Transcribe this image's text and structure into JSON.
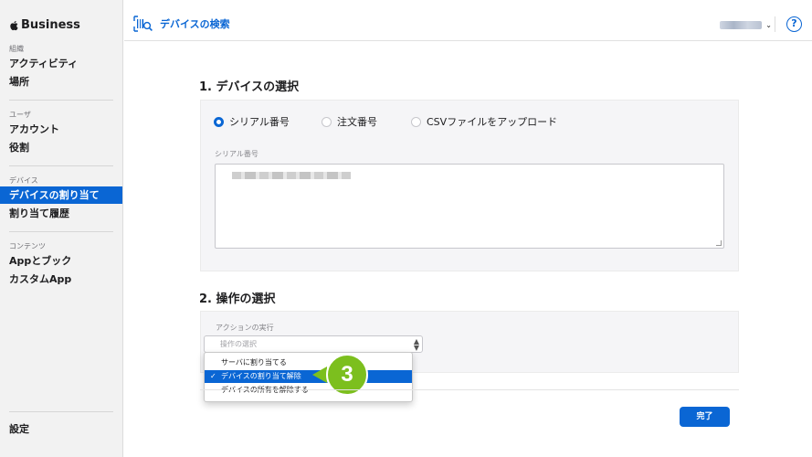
{
  "app": {
    "brand": "Business"
  },
  "sidebar": {
    "sections": [
      {
        "label": "組織",
        "items": [
          "アクティビティ",
          "場所"
        ]
      },
      {
        "label": "ユーザ",
        "items": [
          "アカウント",
          "役割"
        ]
      },
      {
        "label": "デバイス",
        "items": [
          "デバイスの割り当て",
          "割り当て履歴"
        ]
      },
      {
        "label": "コンテンツ",
        "items": [
          "Appとブック",
          "カスタムApp"
        ]
      }
    ],
    "active_item": "デバイスの割り当て",
    "settings": "設定"
  },
  "topbar": {
    "title": "デバイスの検索",
    "help": "?"
  },
  "step1": {
    "title": "1. デバイスの選択",
    "radios": [
      "シリアル番号",
      "注文番号",
      "CSVファイルをアップロード"
    ],
    "selected_radio": "シリアル番号",
    "field_label": "シリアル番号"
  },
  "step2": {
    "title": "2. 操作の選択",
    "field_label": "アクションの実行",
    "select_placeholder": "操作の選択",
    "options": [
      "サーバに割り当てる",
      "デバイスの割り当て解除",
      "デバイスの所有を解除する"
    ],
    "selected_option": "デバイスの割り当て解除"
  },
  "buttons": {
    "done": "完了"
  },
  "annotation": {
    "step_number": "3",
    "color": "#7cbf1e"
  },
  "colors": {
    "accent": "#0a66d4",
    "sidebar_bg": "#f2f2f2",
    "panel_bg": "#f5f5f7"
  }
}
